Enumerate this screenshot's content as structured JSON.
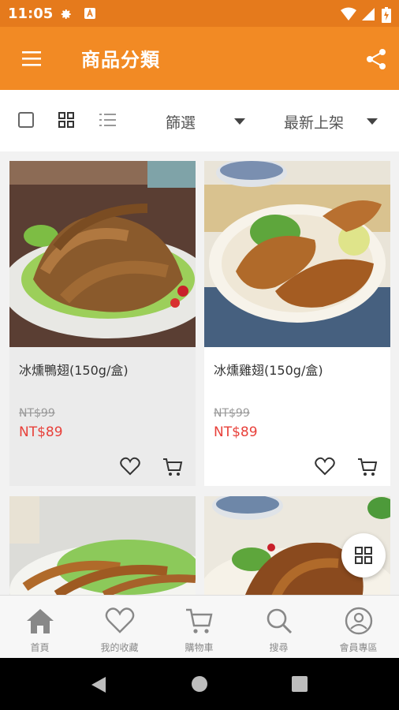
{
  "status_bar": {
    "time": "11:05"
  },
  "app_bar": {
    "title": "商品分類"
  },
  "toolbar": {
    "filter_label": "篩選",
    "sort_label": "最新上架"
  },
  "products": [
    {
      "name": "冰燻鴨翅(150g/盒)",
      "original_price": "NT$99",
      "sale_price": "NT$89"
    },
    {
      "name": "冰燻雞翅(150g/盒)",
      "original_price": "NT$99",
      "sale_price": "NT$89"
    }
  ],
  "bottom_nav": [
    {
      "label": "首頁",
      "icon": "home-icon"
    },
    {
      "label": "我的收藏",
      "icon": "heart-icon"
    },
    {
      "label": "購物車",
      "icon": "cart-icon"
    },
    {
      "label": "搜尋",
      "icon": "search-icon"
    },
    {
      "label": "會員專區",
      "icon": "user-icon"
    }
  ],
  "colors": {
    "app_bar": "#f28a24",
    "status_bar": "#e57a1c",
    "price": "#e8403a"
  }
}
